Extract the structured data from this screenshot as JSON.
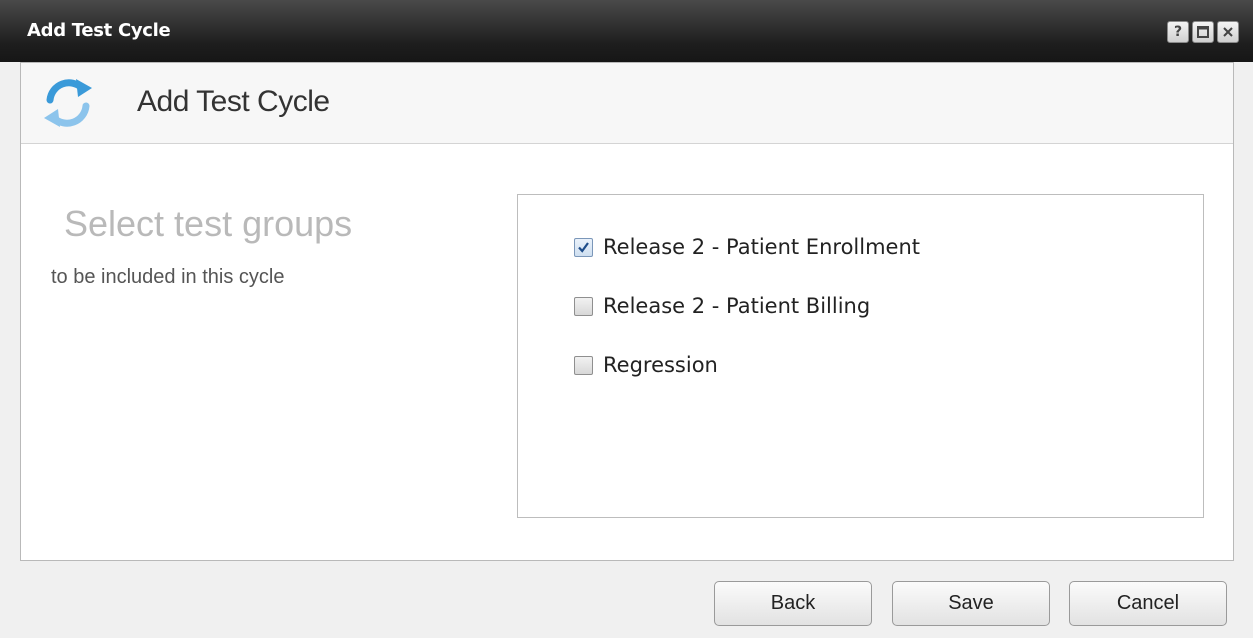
{
  "window": {
    "title": "Add Test Cycle",
    "help_glyph": "?"
  },
  "header": {
    "title": "Add Test Cycle",
    "icon": "refresh-cycle-icon",
    "icon_color": "#3a9ad9"
  },
  "instructions": {
    "heading": "Select test groups",
    "subtext": "to be included in this cycle"
  },
  "groups": [
    {
      "label": "Release 2 - Patient Enrollment",
      "checked": true
    },
    {
      "label": "Release 2 - Patient Billing",
      "checked": false
    },
    {
      "label": "Regression",
      "checked": false
    }
  ],
  "buttons": {
    "back": "Back",
    "save": "Save",
    "cancel": "Cancel"
  }
}
